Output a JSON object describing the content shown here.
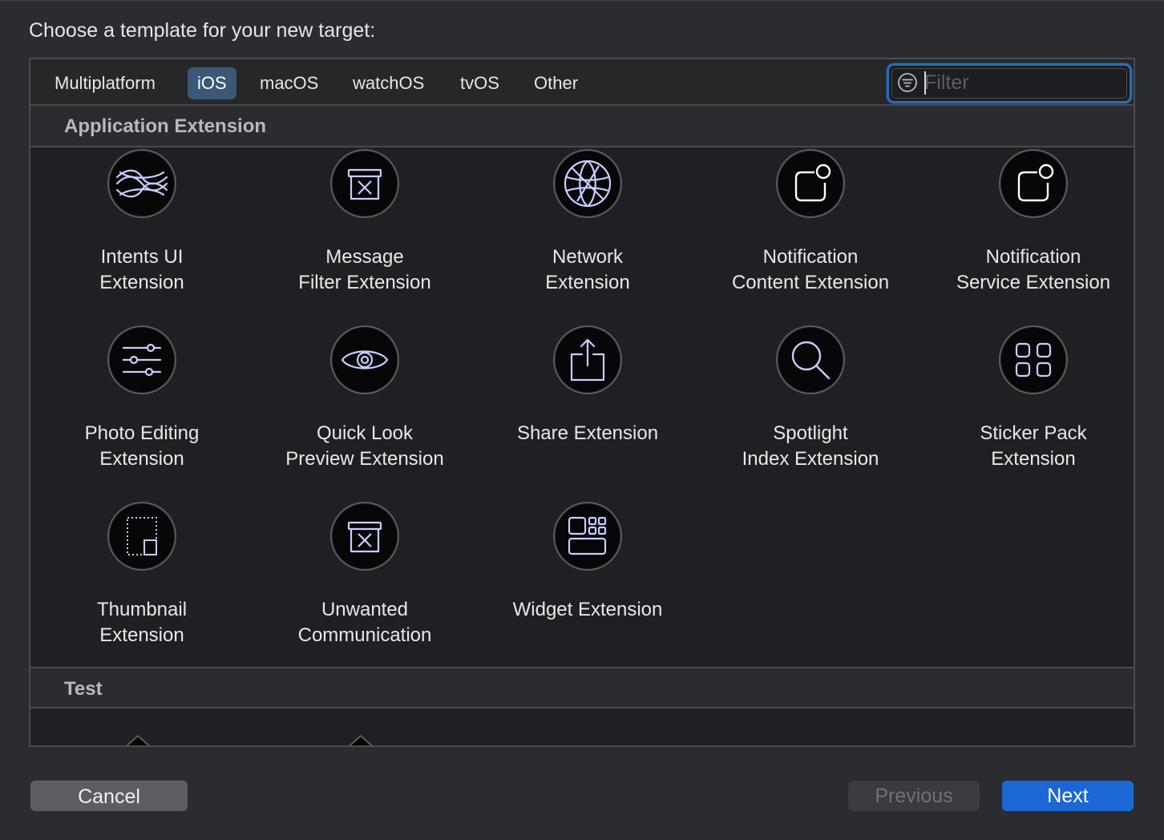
{
  "prompt": "Choose a template for your new target:",
  "tabs": [
    {
      "label": "Multiplatform",
      "active": false
    },
    {
      "label": "iOS",
      "active": true
    },
    {
      "label": "macOS",
      "active": false
    },
    {
      "label": "watchOS",
      "active": false
    },
    {
      "label": "tvOS",
      "active": false
    },
    {
      "label": "Other",
      "active": false
    }
  ],
  "filter": {
    "placeholder": "Filter",
    "value": "",
    "icon": "filter-icon"
  },
  "sections": [
    {
      "title": "Application Extension"
    },
    {
      "title": "Test"
    }
  ],
  "templates": [
    {
      "label": "Intents UI\nExtension",
      "icon": "intents-ui-icon"
    },
    {
      "label": "Message\nFilter Extension",
      "icon": "message-filter-icon"
    },
    {
      "label": "Network\nExtension",
      "icon": "network-globe-icon"
    },
    {
      "label": "Notification\nContent Extension",
      "icon": "notification-content-icon"
    },
    {
      "label": "Notification\nService Extension",
      "icon": "notification-service-icon"
    },
    {
      "label": "Photo Editing\nExtension",
      "icon": "photo-editing-sliders-icon"
    },
    {
      "label": "Quick Look\nPreview Extension",
      "icon": "quick-look-eye-icon"
    },
    {
      "label": "Share Extension",
      "icon": "share-icon"
    },
    {
      "label": "Spotlight\nIndex Extension",
      "icon": "spotlight-magnifier-icon"
    },
    {
      "label": "Sticker Pack\nExtension",
      "icon": "sticker-pack-grid-icon"
    },
    {
      "label": "Thumbnail\nExtension",
      "icon": "thumbnail-icon"
    },
    {
      "label": "Unwanted\nCommunication",
      "icon": "unwanted-communication-icon"
    },
    {
      "label": "Widget Extension",
      "icon": "widget-icon"
    }
  ],
  "buttons": {
    "cancel": "Cancel",
    "previous": "Previous",
    "previous_enabled": false,
    "next": "Next"
  },
  "colors": {
    "accent": "#1c67d6",
    "selected_tab": "#3b5876",
    "icon_stroke": "#c9ccff"
  }
}
